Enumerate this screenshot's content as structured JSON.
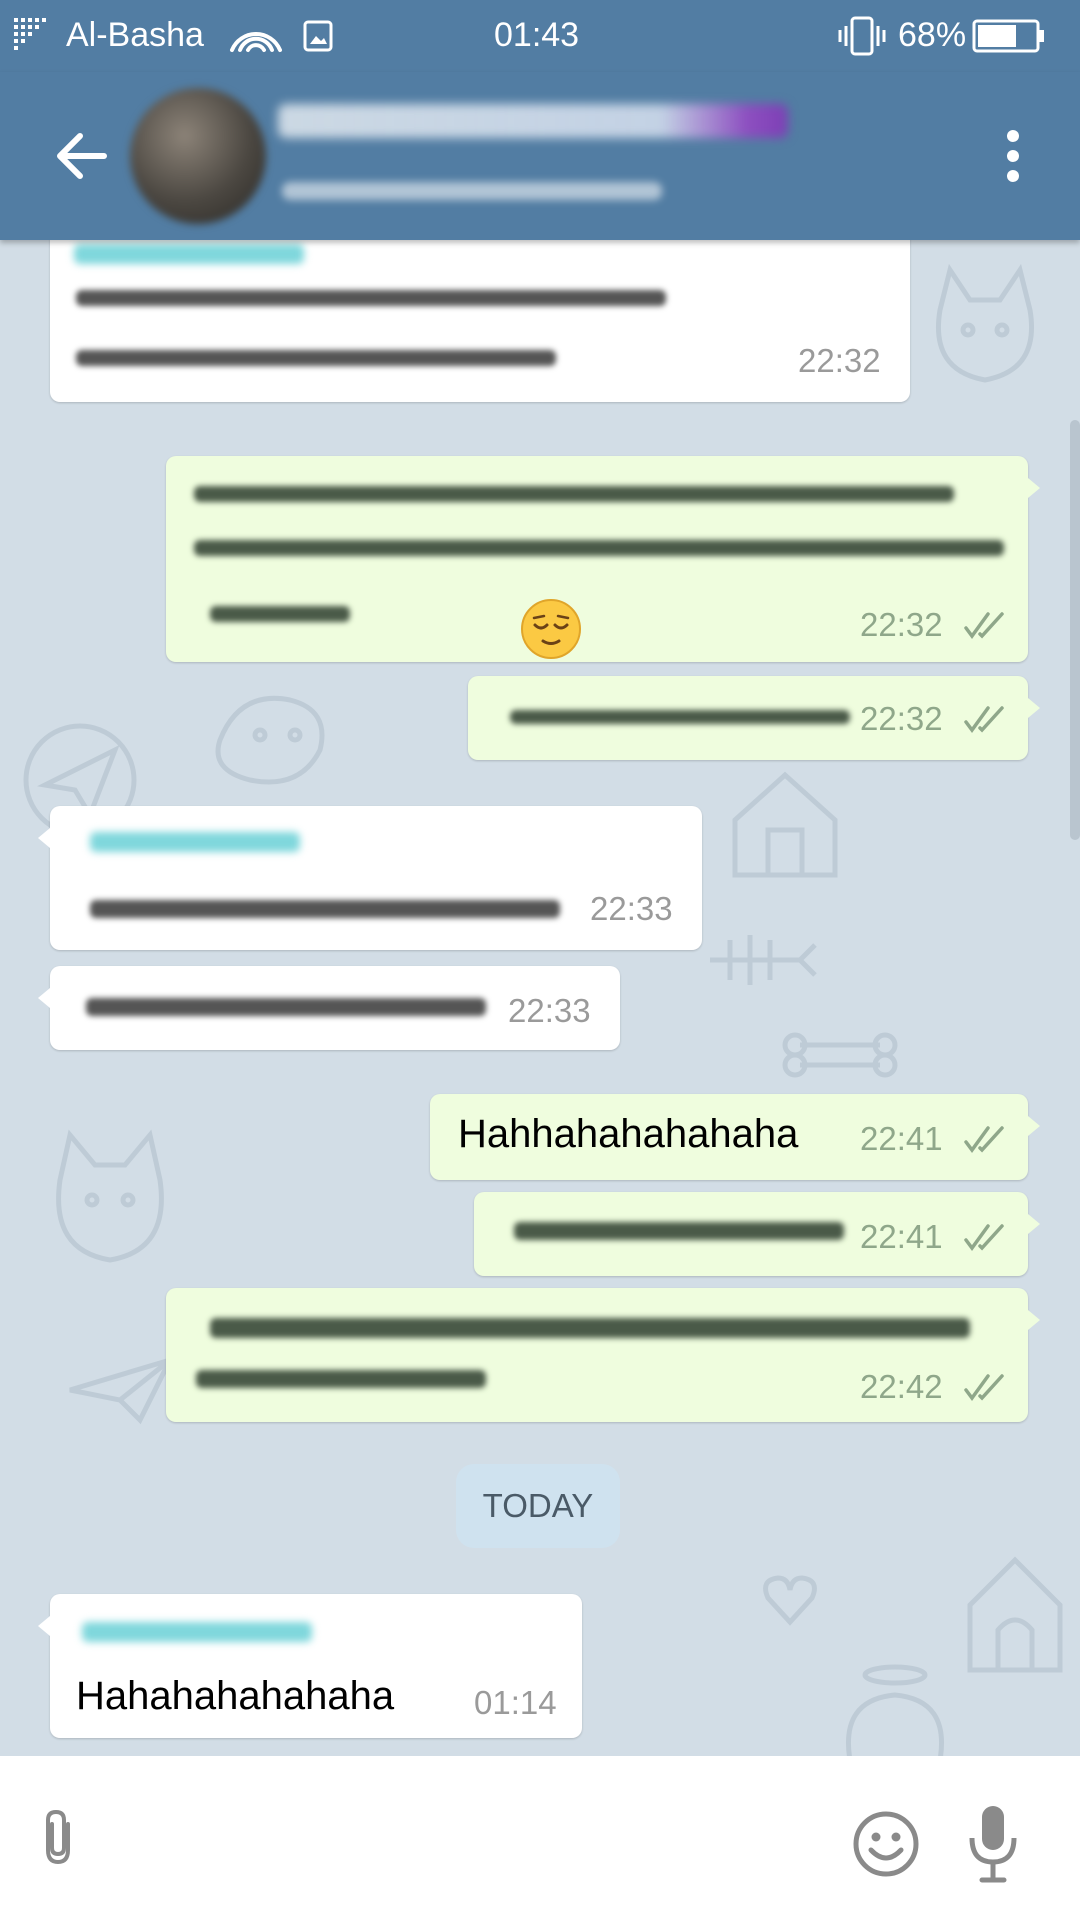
{
  "status_bar": {
    "carrier": "Al-Basha",
    "time": "01:43",
    "battery": "68%",
    "icons": [
      "signal-icon",
      "wifi-icon",
      "image-notification-icon",
      "vibrate-icon",
      "battery-icon"
    ]
  },
  "header": {
    "icons": [
      "back-arrow-icon",
      "more-vert-icon"
    ]
  },
  "messages": [
    {
      "direction": "in",
      "time": "22:32"
    },
    {
      "direction": "out",
      "time": "22:32",
      "read": true
    },
    {
      "direction": "out",
      "time": "22:32",
      "read": true
    },
    {
      "direction": "in",
      "time": "22:33"
    },
    {
      "direction": "in",
      "time": "22:33"
    },
    {
      "direction": "out",
      "text": "Hahhahahahahaha",
      "time": "22:41",
      "read": true
    },
    {
      "direction": "out",
      "time": "22:41",
      "read": true
    },
    {
      "direction": "out",
      "time": "22:42",
      "read": true
    },
    {
      "direction": "in",
      "text": "Hahahahahahaha",
      "time": "01:14"
    }
  ],
  "date_separator": "TODAY",
  "input_bar": {
    "icons": [
      "attach-icon",
      "emoji-icon",
      "mic-icon"
    ]
  },
  "colors": {
    "header": "#527DA3",
    "chat_background": "#D2DDE6",
    "outgoing_bubble": "#EFFDDE",
    "incoming_bubble": "#FFFFFF"
  }
}
